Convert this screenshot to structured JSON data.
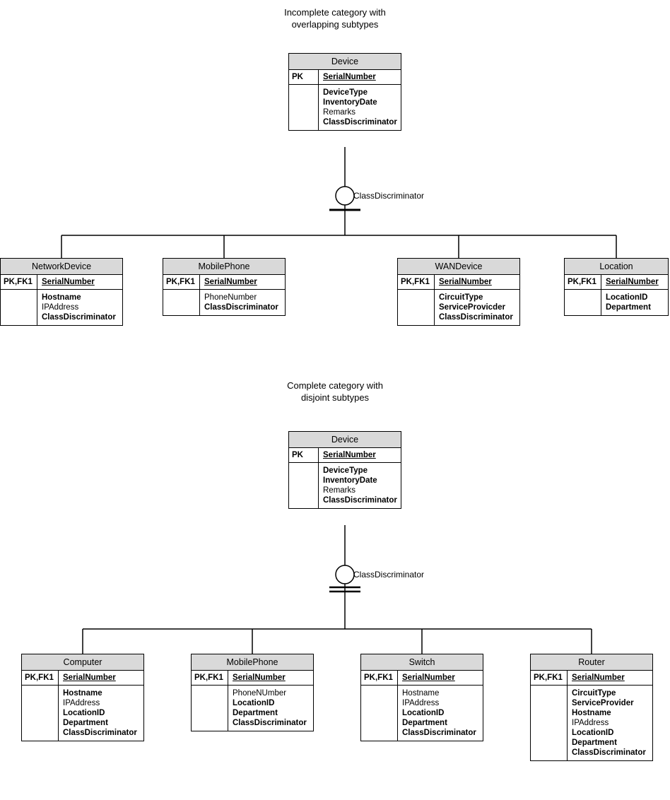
{
  "section1": {
    "title_line1": "Incomplete category with",
    "title_line2": "overlapping subtypes",
    "discriminator": "ClassDiscriminator",
    "parent": {
      "name": "Device",
      "pk_label": "PK",
      "pk_attr": "SerialNumber",
      "attrs": [
        {
          "text": "DeviceType",
          "bold": true
        },
        {
          "text": "InventoryDate",
          "bold": true
        },
        {
          "text": "Remarks",
          "bold": false
        },
        {
          "text": "ClassDiscriminator",
          "bold": true
        }
      ]
    },
    "children": [
      {
        "name": "NetworkDevice",
        "pk_label": "PK,FK1",
        "pk_attr": "SerialNumber",
        "attrs": [
          {
            "text": "Hostname",
            "bold": true
          },
          {
            "text": "IPAddress",
            "bold": false
          },
          {
            "text": "ClassDiscriminator",
            "bold": true
          }
        ]
      },
      {
        "name": "MobilePhone",
        "pk_label": "PK,FK1",
        "pk_attr": "SerialNumber",
        "attrs": [
          {
            "text": "PhoneNumber",
            "bold": false
          },
          {
            "text": "ClassDiscriminator",
            "bold": true
          }
        ]
      },
      {
        "name": "WANDevice",
        "pk_label": "PK,FK1",
        "pk_attr": "SerialNumber",
        "attrs": [
          {
            "text": "CircuitType",
            "bold": true
          },
          {
            "text": "ServiceProvicder",
            "bold": true
          },
          {
            "text": "ClassDiscriminator",
            "bold": true
          }
        ]
      },
      {
        "name": "Location",
        "pk_label": "PK,FK1",
        "pk_attr": "SerialNumber",
        "attrs": [
          {
            "text": "LocationID",
            "bold": true
          },
          {
            "text": "Department",
            "bold": true
          }
        ]
      }
    ]
  },
  "section2": {
    "title_line1": "Complete category with",
    "title_line2": "disjoint subtypes",
    "discriminator": "ClassDiscriminator",
    "parent": {
      "name": "Device",
      "pk_label": "PK",
      "pk_attr": "SerialNumber",
      "attrs": [
        {
          "text": "DeviceType",
          "bold": true
        },
        {
          "text": "InventoryDate",
          "bold": true
        },
        {
          "text": "Remarks",
          "bold": false
        },
        {
          "text": "ClassDiscriminator",
          "bold": true
        }
      ]
    },
    "children": [
      {
        "name": "Computer",
        "pk_label": "PK,FK1",
        "pk_attr": "SerialNumber",
        "attrs": [
          {
            "text": "Hostname",
            "bold": true
          },
          {
            "text": "IPAddress",
            "bold": false
          },
          {
            "text": "LocationID",
            "bold": true
          },
          {
            "text": "Department",
            "bold": true
          },
          {
            "text": "ClassDiscriminator",
            "bold": true
          }
        ]
      },
      {
        "name": "MobilePhone",
        "pk_label": "PK,FK1",
        "pk_attr": "SerialNumber",
        "attrs": [
          {
            "text": "PhoneNUmber",
            "bold": false
          },
          {
            "text": "LocationID",
            "bold": true
          },
          {
            "text": "Department",
            "bold": true
          },
          {
            "text": "ClassDiscriminator",
            "bold": true
          }
        ]
      },
      {
        "name": "Switch",
        "pk_label": "PK,FK1",
        "pk_attr": "SerialNumber",
        "attrs": [
          {
            "text": "Hostname",
            "bold": false
          },
          {
            "text": "IPAddress",
            "bold": false
          },
          {
            "text": "LocationID",
            "bold": true
          },
          {
            "text": "Department",
            "bold": true
          },
          {
            "text": "ClassDiscriminator",
            "bold": true
          }
        ]
      },
      {
        "name": "Router",
        "pk_label": "PK,FK1",
        "pk_attr": "SerialNumber",
        "attrs": [
          {
            "text": "CircuitType",
            "bold": true
          },
          {
            "text": "ServiceProvider",
            "bold": true
          },
          {
            "text": "Hostname",
            "bold": true
          },
          {
            "text": "IPAddress",
            "bold": false
          },
          {
            "text": "LocationID",
            "bold": true
          },
          {
            "text": "Department",
            "bold": true
          },
          {
            "text": "ClassDiscriminator",
            "bold": true
          }
        ]
      }
    ]
  }
}
